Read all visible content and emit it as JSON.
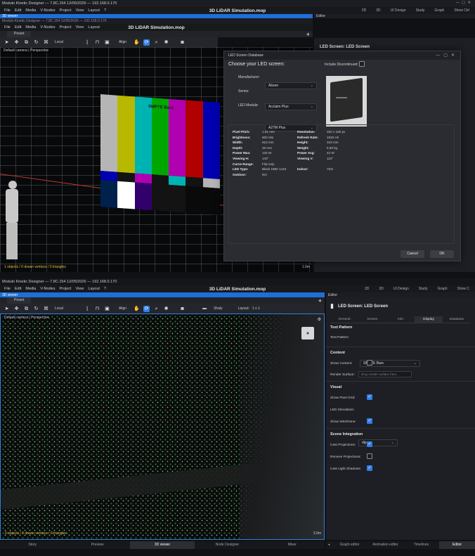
{
  "top": {
    "window_title": "Modulo Kinetic Designer — 7.8C.154 12/05/2026 — 192.168.0.170",
    "menu": [
      "File",
      "Edit",
      "Media",
      "V-Nodes",
      "Project",
      "View",
      "Layout",
      "?"
    ],
    "project_title": "3D LiDAR Simulation.mop",
    "right_menu": [
      "2D",
      "3D",
      "UI Design",
      "Study",
      "Graph",
      "Show Ctrl"
    ],
    "viewer_strip": "3D viewer",
    "editor_strip": "Editor",
    "tab_preset": "Preset",
    "toolbar": {
      "space": "Local",
      "align": "Align"
    },
    "camera_label": "Default camera",
    "camera_mode": "Perspective",
    "stats": "1 objects / 0 drawn vertices / 0 triangles",
    "scale_label": "1.0m",
    "editor_title": "LED Screen: LED Screen",
    "test_card_text": "SMPTE Bars"
  },
  "dialog": {
    "title": "LED Screen Database",
    "heading": "Choose your LED screen:",
    "include_discontinued": "Include Discontinued:",
    "manufacturer_label": "Manufacturer:",
    "manufacturer_value": "Absen",
    "series_label": "Series:",
    "series_value": "Acclaim Plus",
    "module_label": "LED Module:",
    "module_value": "A27M Plus",
    "specs_left": [
      [
        "Pixel Pitch:",
        "1.81 mm"
      ],
      [
        "Brightness:",
        "600 nits"
      ],
      [
        "Width:",
        "610 mm"
      ],
      [
        "Depth:",
        "48 mm"
      ],
      [
        "Power Max:",
        "125 W"
      ],
      [
        "Viewing H:",
        "140°"
      ],
      [
        "Curve Range:",
        "Flat only"
      ],
      [
        "LED Type:",
        "Black SMD 1415"
      ],
      [
        "Outdoor:",
        "NO"
      ]
    ],
    "specs_right": [
      [
        "Resolution:",
        "320 x 180 px"
      ],
      [
        "Refresh Rate:",
        "1920 Hz"
      ],
      [
        "Height:",
        "343 mm"
      ],
      [
        "Weight:",
        "6.60 kg"
      ],
      [
        "Power Avg:",
        "42 W"
      ],
      [
        "Viewing V:",
        "110°"
      ],
      [
        "Indoor:",
        "YES"
      ]
    ],
    "cancel": "Cancel",
    "ok": "OK"
  },
  "bottom": {
    "window_title": "Modulo Kinetic Designer — 7.8C.154 12/05/2026 — 192.168.0.170",
    "menu": [
      "File",
      "Edit",
      "Media",
      "V-Nodes",
      "Project",
      "View",
      "Layout",
      "?"
    ],
    "project_title": "3D LiDAR Simulation.mop",
    "right_menu": [
      "2D",
      "3D",
      "UI Design",
      "Study",
      "Graph",
      "Show C"
    ],
    "viewer_strip": "3D viewer",
    "editor_strip": "Editor",
    "tab_preset": "Preset",
    "toolbar": {
      "space": "Local",
      "align": "Align",
      "shading": "Shaly",
      "layout": "Layout:",
      "layout_value": "1 x 1"
    },
    "camera_label": "Default camera",
    "camera_mode": "Perspective",
    "stats": "0 objects / 0 drawn vertices / 0 triangles",
    "scale_label": "3.0m",
    "editor_title": "LED Screen: LED Screen",
    "tabs": [
      "General",
      "Screen",
      "Info",
      "Display",
      "Database"
    ],
    "active_tab": "Display",
    "sections": {
      "test_pattern": {
        "title": "Test Pattern",
        "label": "Test Pattern:",
        "value": "SMPTE Bars"
      },
      "content": {
        "title": "Content",
        "show_content": "Show Content:",
        "render_surface": "Render Surface:",
        "render_placeholder": "Drop render surface here..."
      },
      "visual": {
        "title": "Visual",
        "show_pixel_grid": "Show Pixel Grid:",
        "led_simulation": "LED Simulation:",
        "led_simulation_value": "dip",
        "show_wireframe": "Show Wireframe:"
      },
      "scene": {
        "title": "Scene Integration",
        "cast_projections": "Cast Projections:",
        "receive_projections": "Receive Projections:",
        "cast_light_shadows": "Cast Light Shadows:"
      }
    },
    "bottom_tabs": [
      "Story",
      "Preview",
      "3D viewer",
      "Node Designer",
      "Mixer"
    ],
    "bottom_tabs_right": [
      "Graph editor",
      "Animation editor",
      "Timelines",
      "Editor"
    ]
  },
  "colors": {
    "accent": "#2f7fe6",
    "stats": "#e0c040",
    "bg": "#101114"
  }
}
